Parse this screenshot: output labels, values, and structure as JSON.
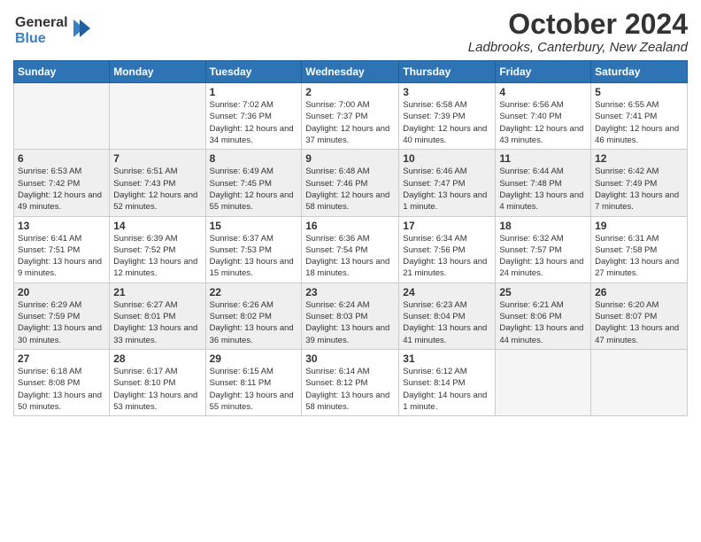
{
  "header": {
    "logo_line1": "General",
    "logo_line2": "Blue",
    "month_title": "October 2024",
    "location": "Ladbrooks, Canterbury, New Zealand"
  },
  "days_of_week": [
    "Sunday",
    "Monday",
    "Tuesday",
    "Wednesday",
    "Thursday",
    "Friday",
    "Saturday"
  ],
  "weeks": [
    [
      {
        "day": "",
        "sunrise": "",
        "sunset": "",
        "daylight": ""
      },
      {
        "day": "",
        "sunrise": "",
        "sunset": "",
        "daylight": ""
      },
      {
        "day": "1",
        "sunrise": "Sunrise: 7:02 AM",
        "sunset": "Sunset: 7:36 PM",
        "daylight": "Daylight: 12 hours and 34 minutes."
      },
      {
        "day": "2",
        "sunrise": "Sunrise: 7:00 AM",
        "sunset": "Sunset: 7:37 PM",
        "daylight": "Daylight: 12 hours and 37 minutes."
      },
      {
        "day": "3",
        "sunrise": "Sunrise: 6:58 AM",
        "sunset": "Sunset: 7:39 PM",
        "daylight": "Daylight: 12 hours and 40 minutes."
      },
      {
        "day": "4",
        "sunrise": "Sunrise: 6:56 AM",
        "sunset": "Sunset: 7:40 PM",
        "daylight": "Daylight: 12 hours and 43 minutes."
      },
      {
        "day": "5",
        "sunrise": "Sunrise: 6:55 AM",
        "sunset": "Sunset: 7:41 PM",
        "daylight": "Daylight: 12 hours and 46 minutes."
      }
    ],
    [
      {
        "day": "6",
        "sunrise": "Sunrise: 6:53 AM",
        "sunset": "Sunset: 7:42 PM",
        "daylight": "Daylight: 12 hours and 49 minutes."
      },
      {
        "day": "7",
        "sunrise": "Sunrise: 6:51 AM",
        "sunset": "Sunset: 7:43 PM",
        "daylight": "Daylight: 12 hours and 52 minutes."
      },
      {
        "day": "8",
        "sunrise": "Sunrise: 6:49 AM",
        "sunset": "Sunset: 7:45 PM",
        "daylight": "Daylight: 12 hours and 55 minutes."
      },
      {
        "day": "9",
        "sunrise": "Sunrise: 6:48 AM",
        "sunset": "Sunset: 7:46 PM",
        "daylight": "Daylight: 12 hours and 58 minutes."
      },
      {
        "day": "10",
        "sunrise": "Sunrise: 6:46 AM",
        "sunset": "Sunset: 7:47 PM",
        "daylight": "Daylight: 13 hours and 1 minute."
      },
      {
        "day": "11",
        "sunrise": "Sunrise: 6:44 AM",
        "sunset": "Sunset: 7:48 PM",
        "daylight": "Daylight: 13 hours and 4 minutes."
      },
      {
        "day": "12",
        "sunrise": "Sunrise: 6:42 AM",
        "sunset": "Sunset: 7:49 PM",
        "daylight": "Daylight: 13 hours and 7 minutes."
      }
    ],
    [
      {
        "day": "13",
        "sunrise": "Sunrise: 6:41 AM",
        "sunset": "Sunset: 7:51 PM",
        "daylight": "Daylight: 13 hours and 9 minutes."
      },
      {
        "day": "14",
        "sunrise": "Sunrise: 6:39 AM",
        "sunset": "Sunset: 7:52 PM",
        "daylight": "Daylight: 13 hours and 12 minutes."
      },
      {
        "day": "15",
        "sunrise": "Sunrise: 6:37 AM",
        "sunset": "Sunset: 7:53 PM",
        "daylight": "Daylight: 13 hours and 15 minutes."
      },
      {
        "day": "16",
        "sunrise": "Sunrise: 6:36 AM",
        "sunset": "Sunset: 7:54 PM",
        "daylight": "Daylight: 13 hours and 18 minutes."
      },
      {
        "day": "17",
        "sunrise": "Sunrise: 6:34 AM",
        "sunset": "Sunset: 7:56 PM",
        "daylight": "Daylight: 13 hours and 21 minutes."
      },
      {
        "day": "18",
        "sunrise": "Sunrise: 6:32 AM",
        "sunset": "Sunset: 7:57 PM",
        "daylight": "Daylight: 13 hours and 24 minutes."
      },
      {
        "day": "19",
        "sunrise": "Sunrise: 6:31 AM",
        "sunset": "Sunset: 7:58 PM",
        "daylight": "Daylight: 13 hours and 27 minutes."
      }
    ],
    [
      {
        "day": "20",
        "sunrise": "Sunrise: 6:29 AM",
        "sunset": "Sunset: 7:59 PM",
        "daylight": "Daylight: 13 hours and 30 minutes."
      },
      {
        "day": "21",
        "sunrise": "Sunrise: 6:27 AM",
        "sunset": "Sunset: 8:01 PM",
        "daylight": "Daylight: 13 hours and 33 minutes."
      },
      {
        "day": "22",
        "sunrise": "Sunrise: 6:26 AM",
        "sunset": "Sunset: 8:02 PM",
        "daylight": "Daylight: 13 hours and 36 minutes."
      },
      {
        "day": "23",
        "sunrise": "Sunrise: 6:24 AM",
        "sunset": "Sunset: 8:03 PM",
        "daylight": "Daylight: 13 hours and 39 minutes."
      },
      {
        "day": "24",
        "sunrise": "Sunrise: 6:23 AM",
        "sunset": "Sunset: 8:04 PM",
        "daylight": "Daylight: 13 hours and 41 minutes."
      },
      {
        "day": "25",
        "sunrise": "Sunrise: 6:21 AM",
        "sunset": "Sunset: 8:06 PM",
        "daylight": "Daylight: 13 hours and 44 minutes."
      },
      {
        "day": "26",
        "sunrise": "Sunrise: 6:20 AM",
        "sunset": "Sunset: 8:07 PM",
        "daylight": "Daylight: 13 hours and 47 minutes."
      }
    ],
    [
      {
        "day": "27",
        "sunrise": "Sunrise: 6:18 AM",
        "sunset": "Sunset: 8:08 PM",
        "daylight": "Daylight: 13 hours and 50 minutes."
      },
      {
        "day": "28",
        "sunrise": "Sunrise: 6:17 AM",
        "sunset": "Sunset: 8:10 PM",
        "daylight": "Daylight: 13 hours and 53 minutes."
      },
      {
        "day": "29",
        "sunrise": "Sunrise: 6:15 AM",
        "sunset": "Sunset: 8:11 PM",
        "daylight": "Daylight: 13 hours and 55 minutes."
      },
      {
        "day": "30",
        "sunrise": "Sunrise: 6:14 AM",
        "sunset": "Sunset: 8:12 PM",
        "daylight": "Daylight: 13 hours and 58 minutes."
      },
      {
        "day": "31",
        "sunrise": "Sunrise: 6:12 AM",
        "sunset": "Sunset: 8:14 PM",
        "daylight": "Daylight: 14 hours and 1 minute."
      },
      {
        "day": "",
        "sunrise": "",
        "sunset": "",
        "daylight": ""
      },
      {
        "day": "",
        "sunrise": "",
        "sunset": "",
        "daylight": ""
      }
    ]
  ]
}
